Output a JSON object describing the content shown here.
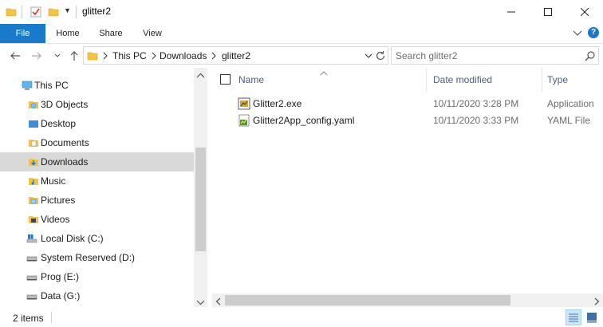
{
  "window": {
    "title": "glitter2",
    "minimize_glyph": "─",
    "maximize_glyph": "☐",
    "close_glyph": "✕"
  },
  "ribbon": {
    "tabs": [
      "File",
      "Home",
      "Share",
      "View"
    ],
    "help_label": "?"
  },
  "address": {
    "breadcrumbs": [
      "This PC",
      "Downloads",
      "glitter2"
    ],
    "separator": ">"
  },
  "search": {
    "placeholder": "Search glitter2"
  },
  "navigation_pane": {
    "items": [
      {
        "label": "This PC",
        "icon": "computer-icon"
      },
      {
        "label": "3D Objects",
        "icon": "3d-objects-folder-icon"
      },
      {
        "label": "Desktop",
        "icon": "desktop-folder-icon"
      },
      {
        "label": "Documents",
        "icon": "documents-folder-icon"
      },
      {
        "label": "Downloads",
        "icon": "downloads-folder-icon",
        "selected": true
      },
      {
        "label": "Music",
        "icon": "music-folder-icon"
      },
      {
        "label": "Pictures",
        "icon": "pictures-folder-icon"
      },
      {
        "label": "Videos",
        "icon": "videos-folder-icon"
      },
      {
        "label": "Local Disk (C:)",
        "icon": "windows-drive-icon"
      },
      {
        "label": "System Reserved (D:)",
        "icon": "drive-icon"
      },
      {
        "label": "Prog (E:)",
        "icon": "drive-icon"
      },
      {
        "label": "Data (G:)",
        "icon": "drive-icon"
      }
    ]
  },
  "file_list": {
    "columns": [
      "Name",
      "Date modified",
      "Type"
    ],
    "files": [
      {
        "name": "Glitter2.exe",
        "date_modified": "10/11/2020 3:28 PM",
        "type": "Application",
        "icon": "exe-app-icon"
      },
      {
        "name": "Glitter2App_config.yaml",
        "date_modified": "10/11/2020 3:33 PM",
        "type": "YAML File",
        "icon": "yaml-file-icon"
      }
    ]
  },
  "status": {
    "item_count": "2 items"
  },
  "colors": {
    "accent": "#1979ca",
    "selection": "#d9d9d9",
    "folder": "#f5c343",
    "header_text": "#4c607a"
  }
}
